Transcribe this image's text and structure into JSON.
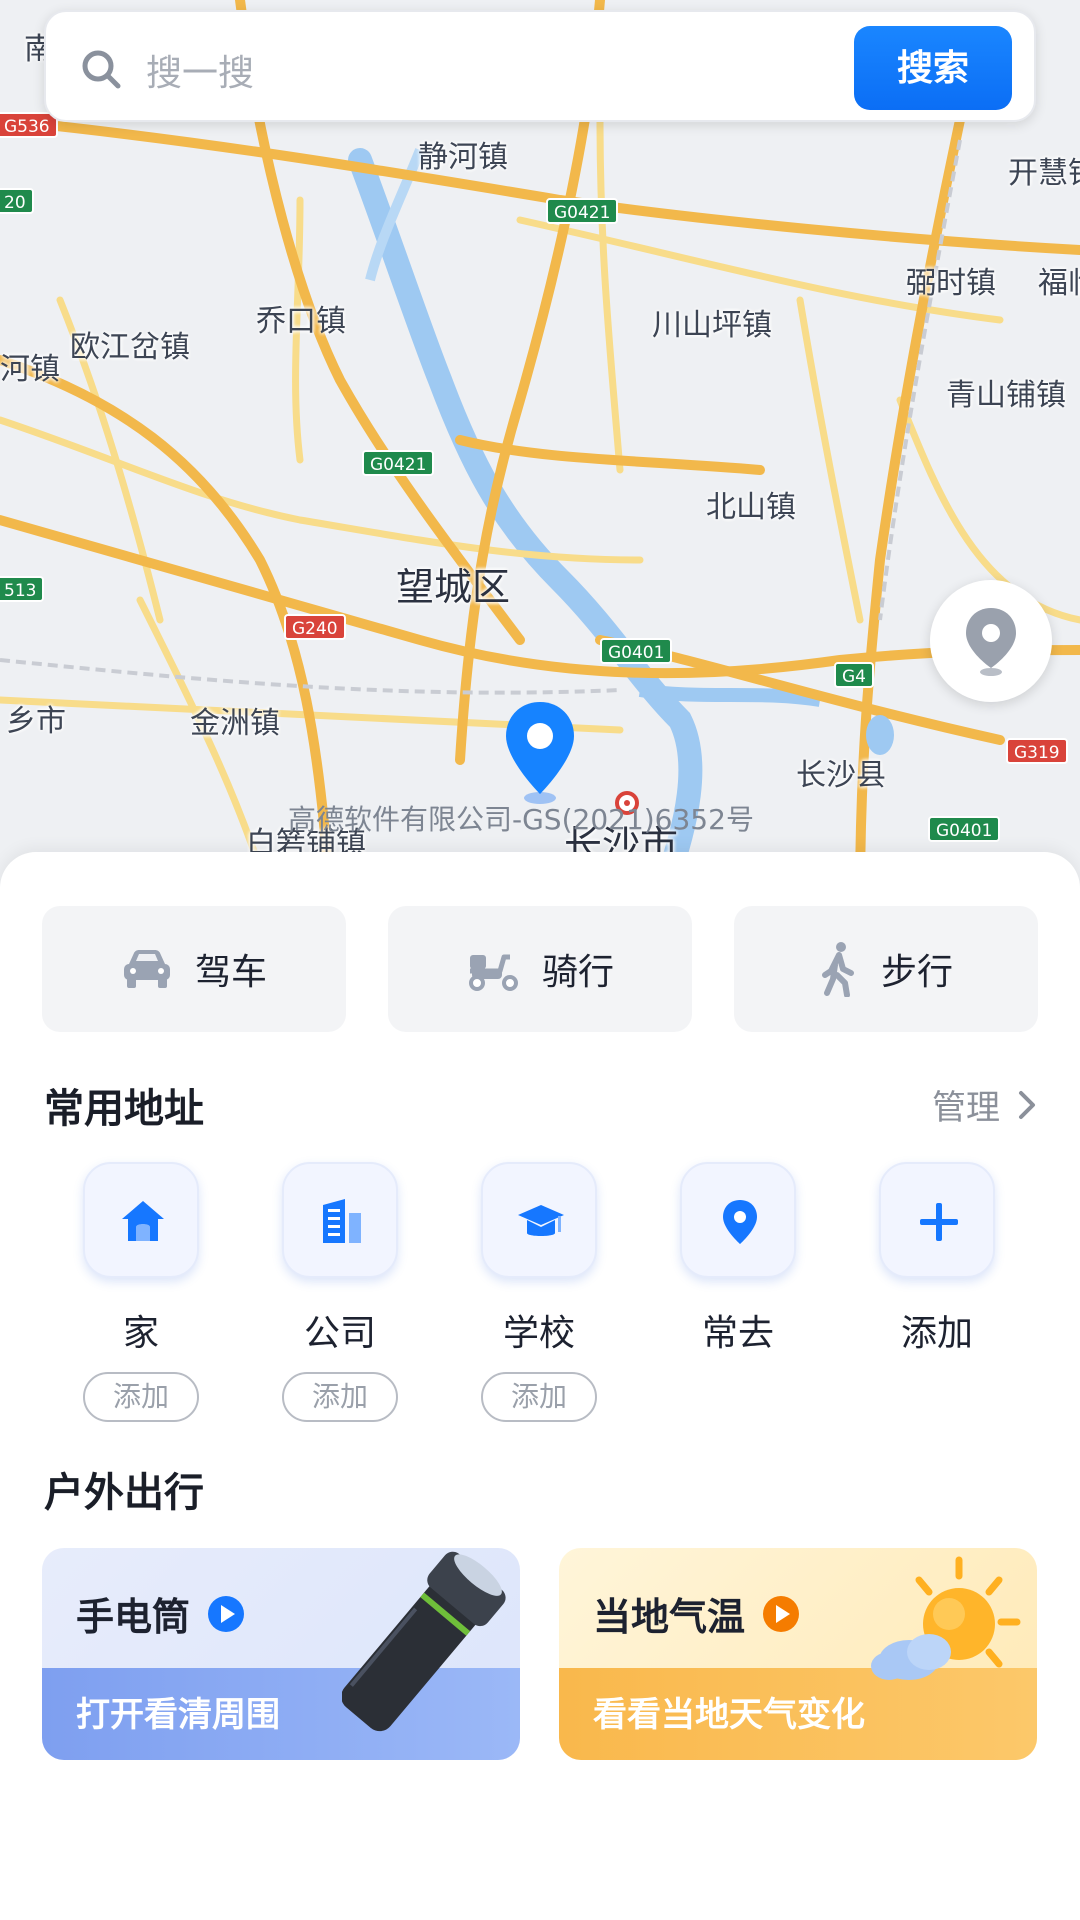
{
  "search": {
    "placeholder": "搜一搜",
    "button": "搜索"
  },
  "map": {
    "places": [
      {
        "id": "jinghezhen",
        "text": "静河镇"
      },
      {
        "id": "kaihui",
        "text": "开慧镇"
      },
      {
        "id": "fushi",
        "text": "弼时镇"
      },
      {
        "id": "fu",
        "text": "福临"
      },
      {
        "id": "qiaokou",
        "text": "乔口镇"
      },
      {
        "id": "oujiang",
        "text": "欧江岔镇"
      },
      {
        "id": "he",
        "text": "河镇"
      },
      {
        "id": "chuanshan",
        "text": "川山坪镇"
      },
      {
        "id": "qingshan",
        "text": "青山铺镇"
      },
      {
        "id": "beishan",
        "text": "北山镇"
      },
      {
        "id": "wangcheng",
        "text": "望城区"
      },
      {
        "id": "xiangshi",
        "text": "乡市"
      },
      {
        "id": "jinzhou",
        "text": "金洲镇"
      },
      {
        "id": "changshaxian",
        "text": "长沙县"
      },
      {
        "id": "baizhu",
        "text": "白箬铺镇"
      },
      {
        "id": "changshashi",
        "text": "长沙市"
      },
      {
        "id": "nan",
        "text": "南"
      }
    ],
    "shields": [
      {
        "id": "g0421a",
        "text": "G0421",
        "color": "green"
      },
      {
        "id": "g0421b",
        "text": "G0421",
        "color": "green"
      },
      {
        "id": "g240",
        "text": "G240",
        "color": "red"
      },
      {
        "id": "g0401a",
        "text": "G0401",
        "color": "green"
      },
      {
        "id": "g4",
        "text": "G4",
        "color": "green"
      },
      {
        "id": "g319",
        "text": "G319",
        "color": "red"
      },
      {
        "id": "g0401b",
        "text": "G0401",
        "color": "green"
      },
      {
        "id": "g536",
        "text": "G536",
        "color": "red"
      },
      {
        "id": "s20",
        "text": "20",
        "color": "green"
      },
      {
        "id": "s513",
        "text": "513",
        "color": "green"
      }
    ],
    "copyright": "高德软件有限公司-GS(2021)6352号"
  },
  "modes": [
    {
      "label": "驾车",
      "icon": "car-icon"
    },
    {
      "label": "骑行",
      "icon": "scooter-icon"
    },
    {
      "label": "步行",
      "icon": "walking-icon"
    }
  ],
  "common": {
    "title": "常用地址",
    "manage": "管理",
    "items": [
      {
        "label": "家",
        "icon": "home-icon",
        "action": "添加"
      },
      {
        "label": "公司",
        "icon": "office-building-icon",
        "action": "添加"
      },
      {
        "label": "学校",
        "icon": "graduation-cap-icon",
        "action": "添加"
      },
      {
        "label": "常去",
        "icon": "location-pin-icon",
        "action": ""
      },
      {
        "label": "添加",
        "icon": "plus-icon",
        "action": ""
      }
    ]
  },
  "outdoor": {
    "title": "户外出行",
    "cards": [
      {
        "title": "手电筒",
        "subtitle": "打开看清周围",
        "accent": "#1677ff"
      },
      {
        "title": "当地气温",
        "subtitle": "看看当地天气变化",
        "accent": "#f57c00"
      }
    ]
  },
  "colors": {
    "primary": "#0b6ef5",
    "road_major": "#f2b84b",
    "road_minor": "#f8dc8a",
    "water": "#9ec9f2",
    "green_shield": "#1f8a4c",
    "red_shield": "#d9433a"
  }
}
